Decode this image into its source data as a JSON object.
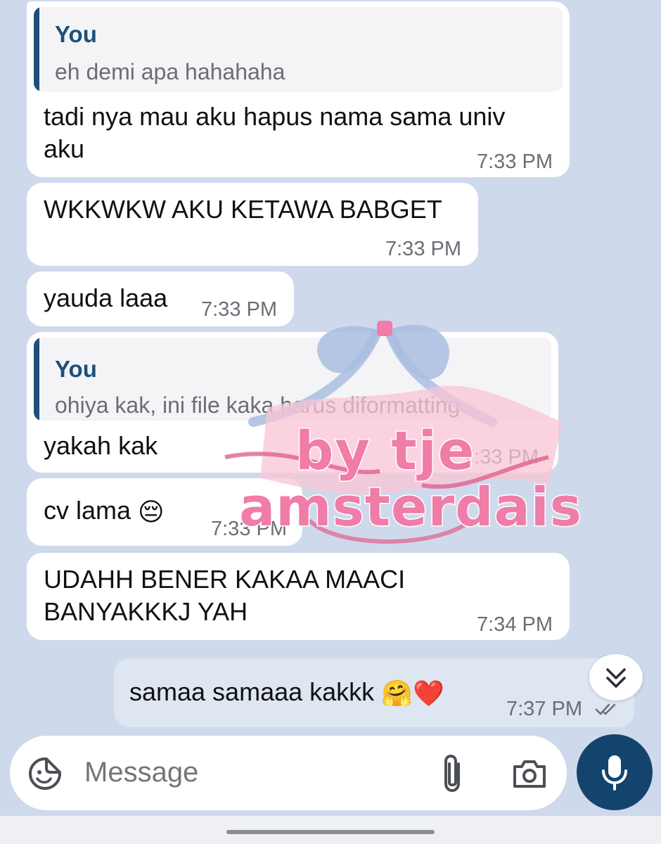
{
  "messages": [
    {
      "reply": {
        "author": "You",
        "text": "eh demi apa hahahaha"
      },
      "lines": [
        "tadi nya mau aku hapus nama sama univ",
        "aku"
      ],
      "time": "7:33 PM"
    },
    {
      "lines": [
        "WKKWKW AKU KETAWA BABGET"
      ],
      "time": "7:33 PM"
    },
    {
      "lines": [
        "yauda laaa"
      ],
      "time": "7:33 PM"
    },
    {
      "reply": {
        "author": "You",
        "text": "ohiya kak, ini file kaka harus diformatting"
      },
      "lines": [
        "yakah kak"
      ],
      "time": "7:33 PM"
    },
    {
      "lines": [
        "cv lama"
      ],
      "emoji": "😔",
      "time": "7:33 PM"
    },
    {
      "lines": [
        "UDAHH BENER KAKAA MAACI",
        "BANYAKKKJ YAH"
      ],
      "time": "7:34 PM"
    },
    {
      "lines": [
        "samaa samaaa kakkk"
      ],
      "emoji": "🤗❤️",
      "time": "7:37 PM",
      "status_icon": "double-check-icon"
    }
  ],
  "composer": {
    "placeholder": "Message"
  },
  "icons": {
    "sticker": "sticker-icon",
    "attach": "paperclip-icon",
    "camera": "camera-icon",
    "mic": "microphone-icon",
    "scroll_down": "double-chevron-down-icon"
  },
  "watermark": {
    "line1": "by tje",
    "line2": "amsterdais"
  },
  "colors": {
    "background": "#cfd9ec",
    "incoming_bubble": "#ffffff",
    "outgoing_bubble": "#dde6f1",
    "accent": "#1d4f7a",
    "mic_button": "#13446d",
    "watermark": "#f07ca8"
  }
}
